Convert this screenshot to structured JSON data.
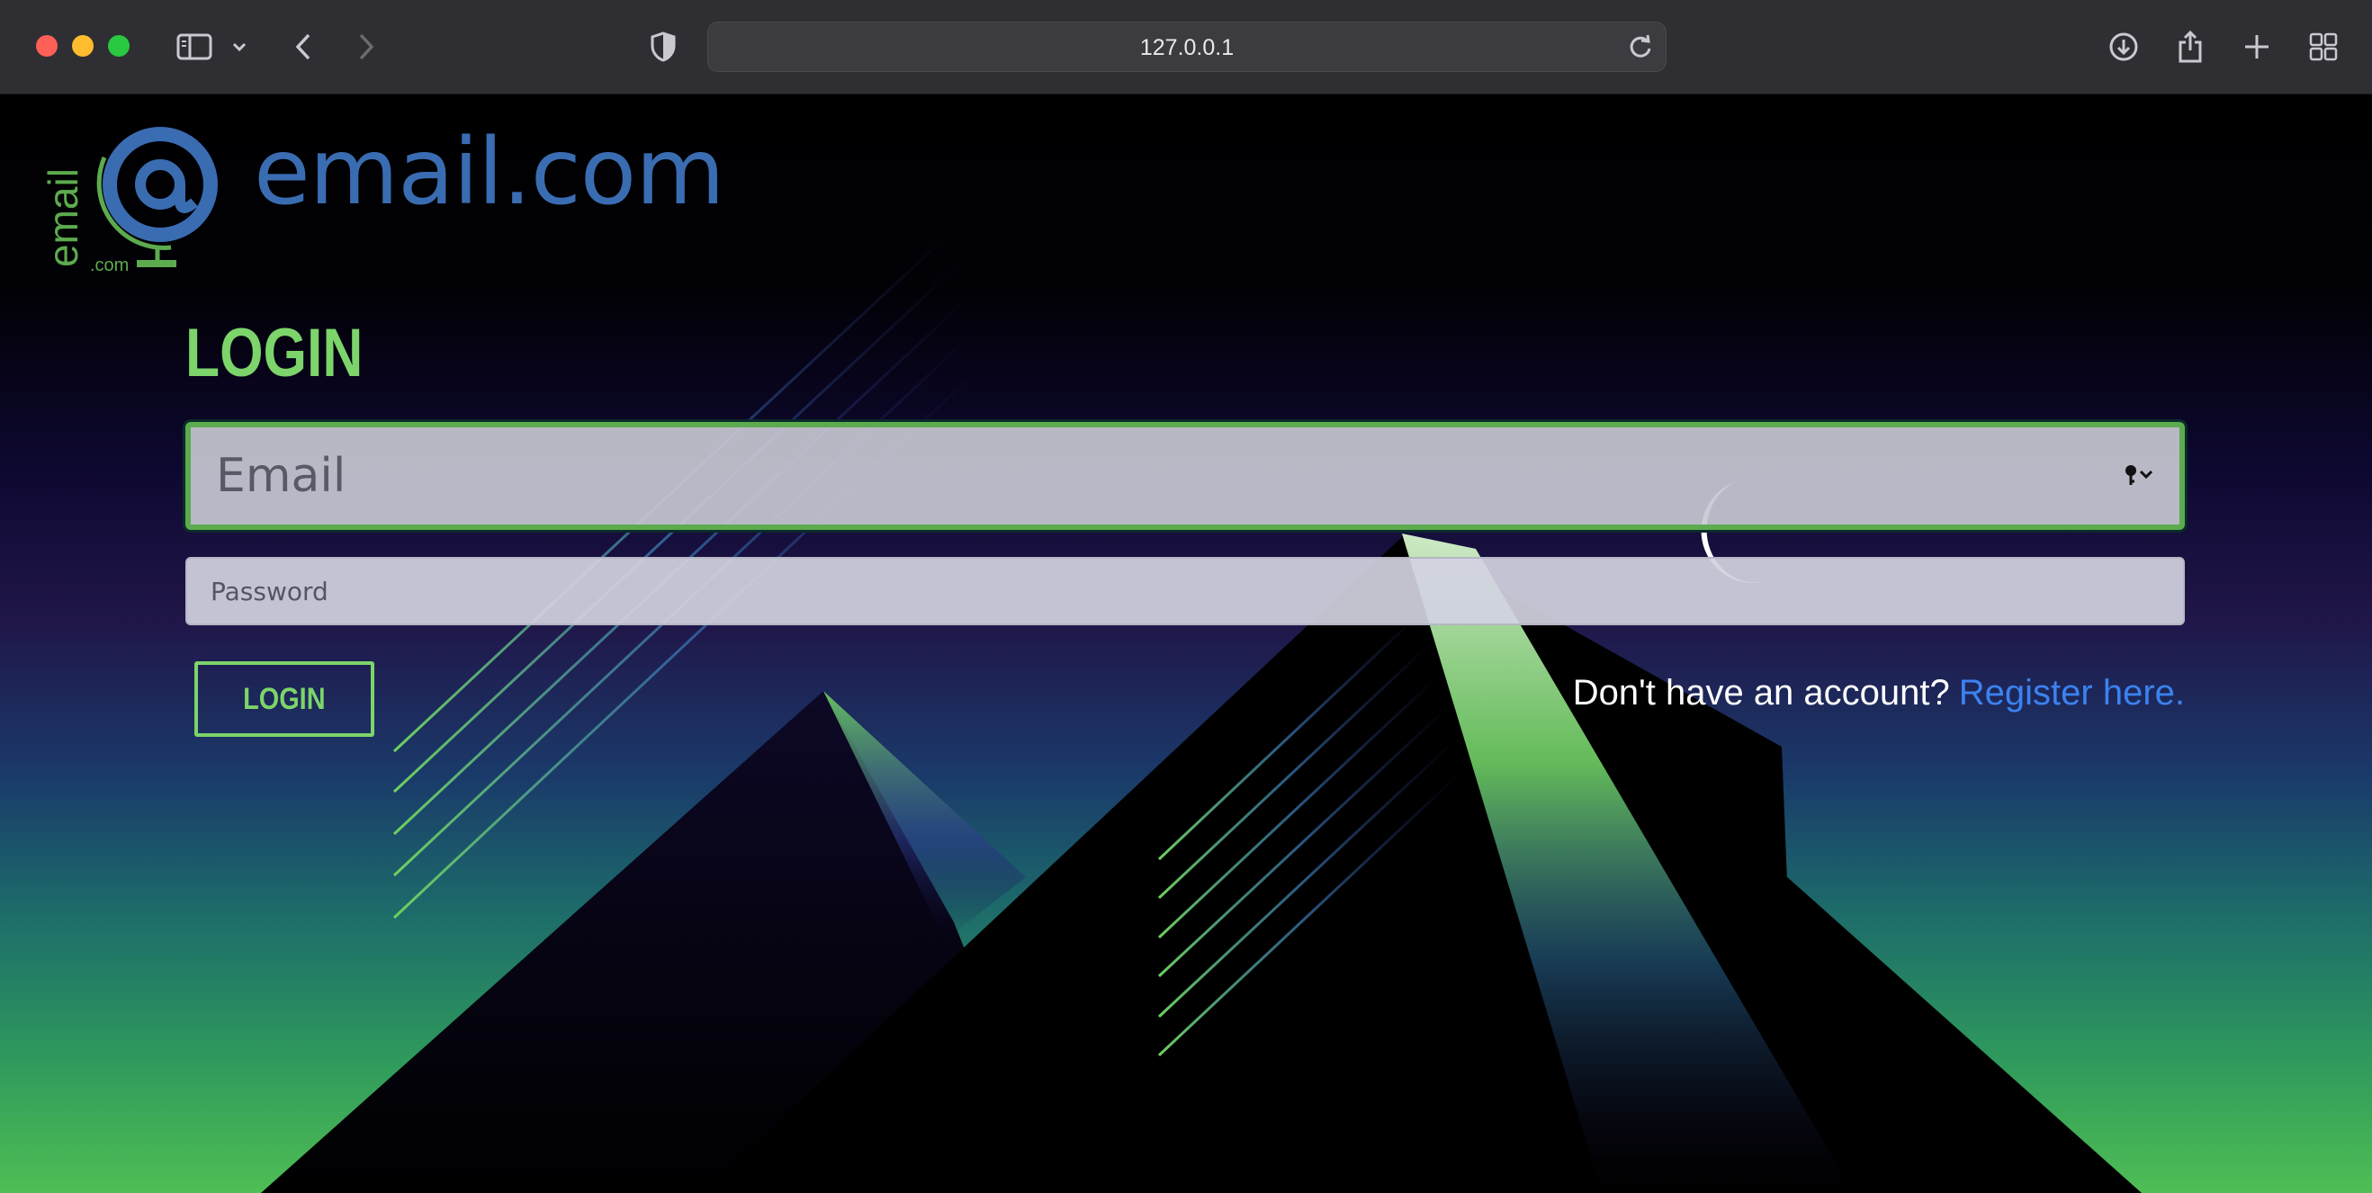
{
  "browser": {
    "url": "127.0.0.1",
    "icons": [
      "sidebar-icon",
      "chevron-down-icon",
      "back-icon",
      "forward-icon",
      "shield-icon",
      "reload-icon",
      "download-icon",
      "share-icon",
      "new-tab-icon",
      "tab-overview-icon"
    ]
  },
  "brand": {
    "logo_text": "email",
    "logo_suffix": ".com",
    "name": "email.com",
    "color": "#3a6cb2",
    "accent": "#7cd46a"
  },
  "form": {
    "heading": "LOGIN",
    "email_placeholder": "Email",
    "password_placeholder": "Password",
    "submit_label": "LOGIN",
    "register_prompt": "Don't have an account?",
    "register_link": "Register here.",
    "link_color": "#3b82f0"
  }
}
